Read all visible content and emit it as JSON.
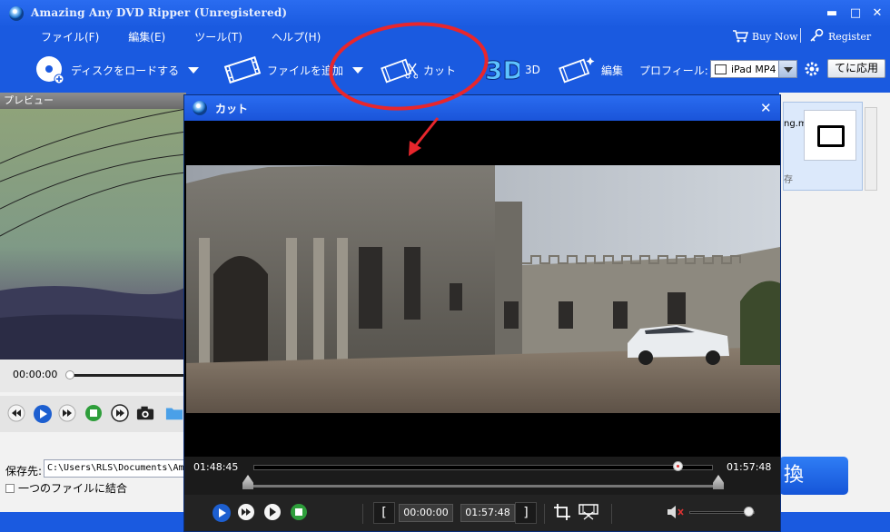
{
  "window": {
    "title": "Amazing Any DVD Ripper (Unregistered)"
  },
  "menu": [
    "ファイル(F)",
    "編集(E)",
    "ツール(T)",
    "ヘルプ(H)"
  ],
  "top_links": {
    "buy": "Buy Now",
    "register": "Register"
  },
  "toolbar": {
    "load_disc": "ディスクをロードする",
    "add_file": "ファイルを追加",
    "cut": "カット",
    "three_d": "3D",
    "edit": "編集",
    "profile_label": "プロフィール:",
    "profile_value": "iPad MP4",
    "apply": "てに応用"
  },
  "preview": {
    "header": "プレビュー",
    "time": "00:00:00"
  },
  "file_list": {
    "file_name": "ng.mp",
    "sub": "存"
  },
  "output": {
    "label": "保存先:",
    "path": "C:\\Users\\RLS\\Documents\\Ama",
    "merge_label": "一つのファイルに結合"
  },
  "convert_button": "換",
  "cut_dialog": {
    "title": "カット",
    "start_time": "01:48:45",
    "end_time": "01:57:48",
    "begin_box": "00:00:00",
    "end_box": "01:57:48",
    "progress": 0.925
  },
  "annotation": {
    "color": "#e8262c"
  },
  "colors": {
    "window_blue": "#1a5ae0",
    "dialog_bg": "#000000",
    "accent_red": "#e8262c"
  }
}
